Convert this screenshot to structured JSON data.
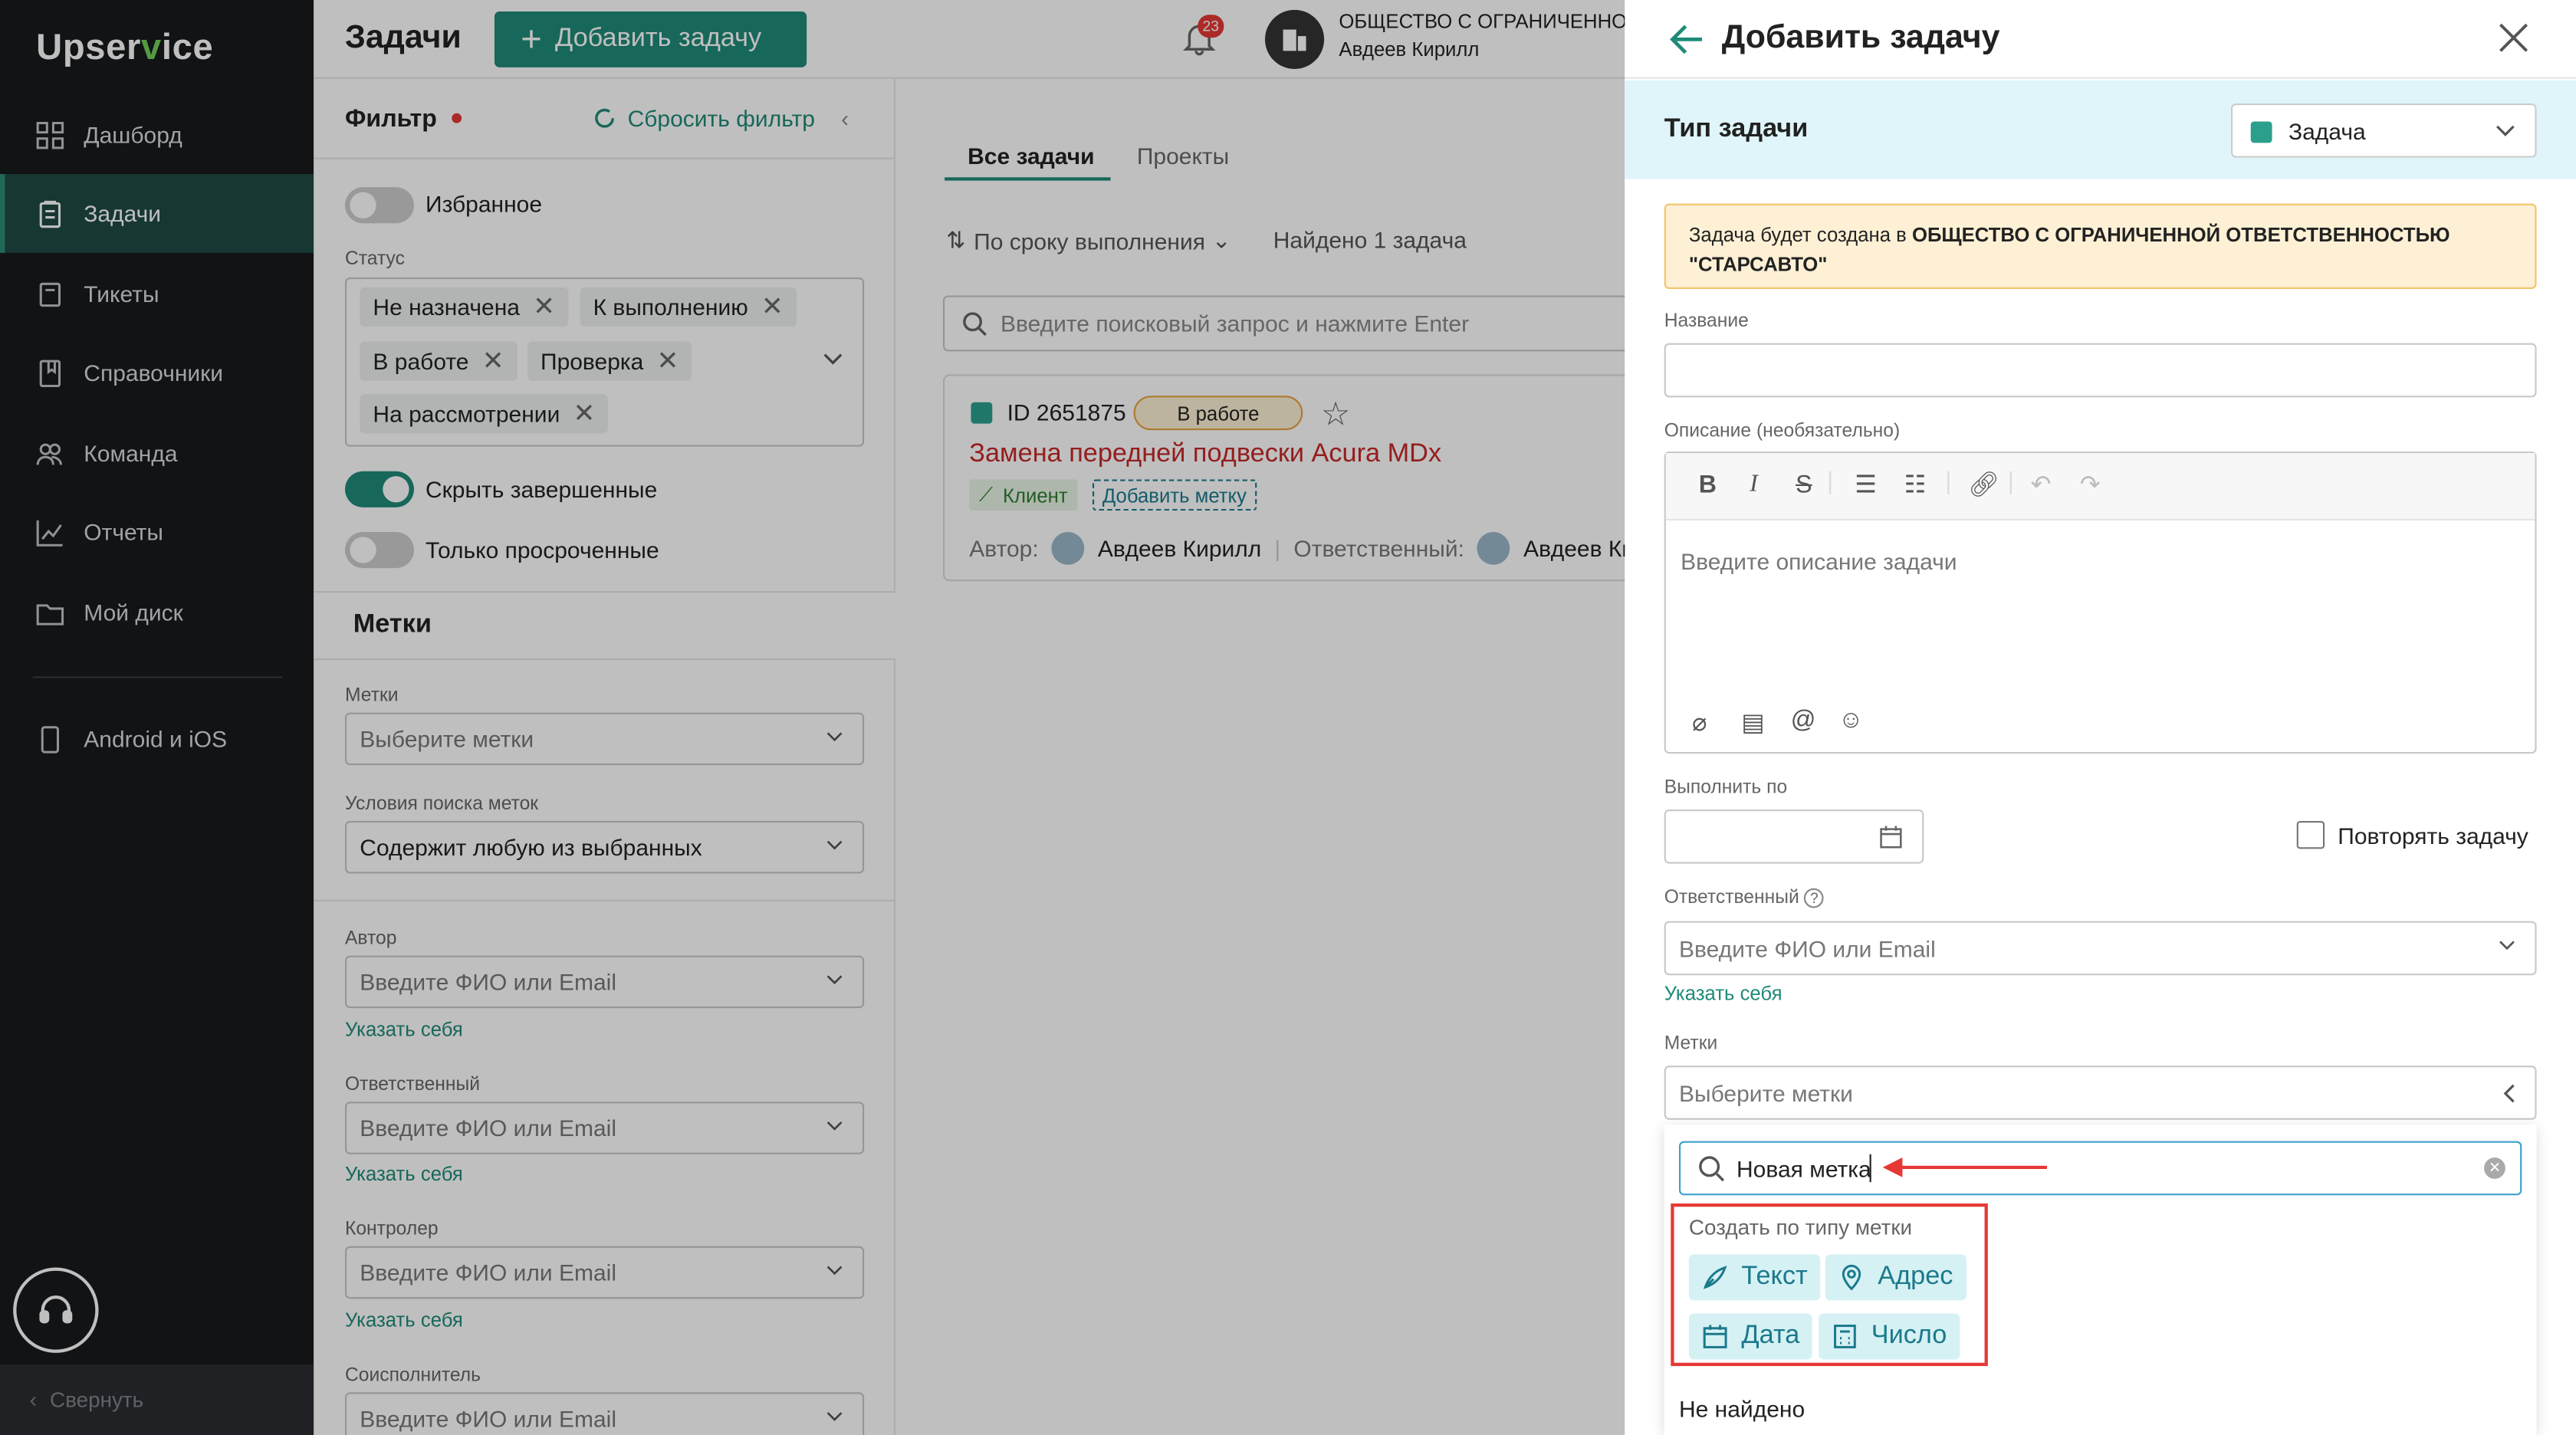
{
  "app": {
    "logo_a": "Upser",
    "logo_b": "v",
    "logo_c": "ice"
  },
  "sidebar": {
    "items": [
      {
        "label": "Дашборд",
        "icon": "dashboard-icon"
      },
      {
        "label": "Задачи",
        "icon": "tasks-icon",
        "active": true
      },
      {
        "label": "Тикеты",
        "icon": "tickets-icon"
      },
      {
        "label": "Справочники",
        "icon": "book-icon"
      },
      {
        "label": "Команда",
        "icon": "team-icon"
      },
      {
        "label": "Отчеты",
        "icon": "chart-icon"
      },
      {
        "label": "Мой диск",
        "icon": "folder-icon"
      }
    ],
    "mobile": "Android и iOS",
    "collapse": "Свернуть"
  },
  "header": {
    "title": "Задачи",
    "add_button": "Добавить задачу",
    "notifications": "23",
    "org": "ОБЩЕСТВО С ОГРАНИЧЕННОЙ ОТВЕТСТВЕННОСТЬЮ",
    "user": "Авдеев Кирилл"
  },
  "filter": {
    "title": "Фильтр",
    "reset": "Сбросить фильтр",
    "favorites": "Избранное",
    "status_label": "Статус",
    "statuses": [
      "Не назначена",
      "К выполнению",
      "В работе",
      "Проверка",
      "На рассмотрении"
    ],
    "hide_done": "Скрыть завершенные",
    "overdue_only": "Только просроченные",
    "tags_section": "Метки",
    "tags_label": "Метки",
    "tags_placeholder": "Выберите метки",
    "cond_label": "Условия поиска меток",
    "cond_value": "Содержит любую из выбранных",
    "author_label": "Автор",
    "assignee_label": "Ответственный",
    "controller_label": "Контролер",
    "coexec_label": "Соисполнитель",
    "person_placeholder": "Введите ФИО или Email",
    "self_link": "Указать себя"
  },
  "tasks": {
    "tabs": [
      "Все задачи",
      "Проекты"
    ],
    "sort": "По сроку выполнения",
    "found": "Найдено 1 задача",
    "search_placeholder": "Введите поисковый запрос и нажмите Enter",
    "card": {
      "id": "ID 2651875",
      "status": "В работе",
      "title": "Замена передней подвески Acura MDx",
      "tag": "Клиент",
      "add_tag": "Добавить метку",
      "author_label": "Автор:",
      "author": "Авдеев Кирилл",
      "assignee_label": "Ответственный:",
      "assignee": "Авдеев Кир"
    }
  },
  "panel": {
    "title": "Добавить задачу",
    "type_label": "Тип задачи",
    "type_value": "Задача",
    "notice_pre": "Задача будет создана в ",
    "notice_org": "ОБЩЕСТВО С ОГРАНИЧЕННОЙ ОТВЕТСТВЕННОСТЬЮ",
    "notice_org2": "\"СТАРСАВТО\"",
    "name_label": "Название",
    "desc_label": "Описание (необязательно)",
    "desc_placeholder": "Введите описание задачи",
    "due_label": "Выполнить по",
    "repeat_label": "Повторять задачу",
    "assignee_label": "Ответственный",
    "assignee_placeholder": "Введите ФИО или Email",
    "self_link": "Указать себя",
    "tags_label": "Метки",
    "tags_placeholder": "Выберите метки",
    "tag_search_value": "Новая метка",
    "create_by_type": "Создать по типу метки",
    "tag_types": [
      "Текст",
      "Адрес",
      "Дата",
      "Число"
    ],
    "not_found": "Не найдено"
  },
  "colors": {
    "accent": "#1f8a78",
    "sidebar": "#171a1d",
    "highlight": "#e53935",
    "info_bg": "#dff5f9"
  }
}
